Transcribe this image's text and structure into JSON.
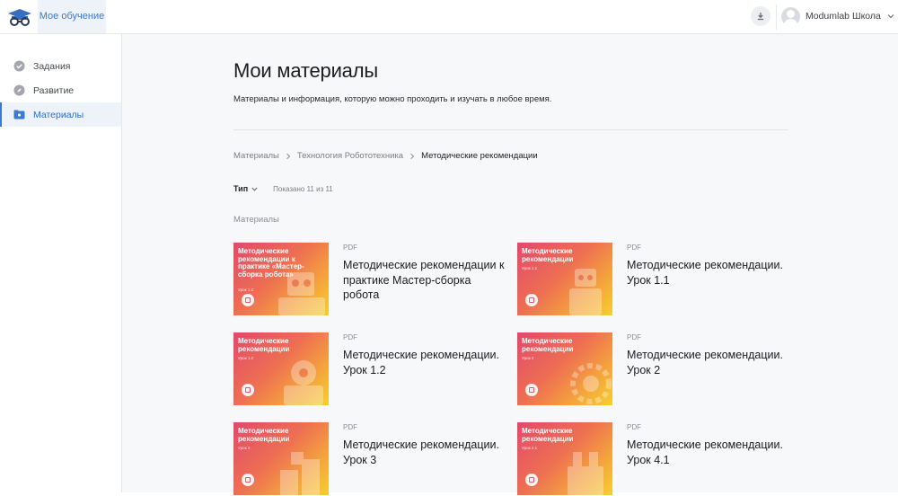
{
  "topbar": {
    "nav_tab_label": "Мое обучение",
    "user_name": "Modumlab Школа"
  },
  "sidebar": {
    "items": [
      {
        "label": "Задания",
        "icon": "check-circle-icon",
        "active": false
      },
      {
        "label": "Развитие",
        "icon": "compass-icon",
        "active": false
      },
      {
        "label": "Материалы",
        "icon": "folder-icon",
        "active": true
      }
    ]
  },
  "main": {
    "title": "Мои материалы",
    "description": "Материалы и информация, которую можно проходить и изучать в любое время.",
    "breadcrumb": [
      "Материалы",
      "Технология Робототехника",
      "Методические рекомендации"
    ],
    "filter": {
      "type_label": "Тип",
      "count_text": "Показано 11 из 11"
    },
    "section_label": "Материалы",
    "cards": [
      {
        "type": "PDF",
        "title": "Методические рекомендации к практике Мастер-сборка робота",
        "thumb_title": "Методические рекомендации к практике «Мастер-сборка робота»",
        "thumb_sub": "Урок 1.2"
      },
      {
        "type": "PDF",
        "title": "Методические рекомендации. Урок 1.1",
        "thumb_title": "Методические рекомендации",
        "thumb_sub": "Урок 1.1"
      },
      {
        "type": "PDF",
        "title": "Методические рекомендации. Урок 1.2",
        "thumb_title": "Методические рекомендации",
        "thumb_sub": "Урок 1.2"
      },
      {
        "type": "PDF",
        "title": "Методические рекомендации. Урок 2",
        "thumb_title": "Методические рекомендации",
        "thumb_sub": "Урок 2"
      },
      {
        "type": "PDF",
        "title": "Методические рекомендации. Урок 3",
        "thumb_title": "Методические рекомендации",
        "thumb_sub": "Урок 3"
      },
      {
        "type": "PDF",
        "title": "Методические рекомендации. Урок 4.1",
        "thumb_title": "Методические рекомендации",
        "thumb_sub": "Урок 4.1"
      }
    ]
  }
}
